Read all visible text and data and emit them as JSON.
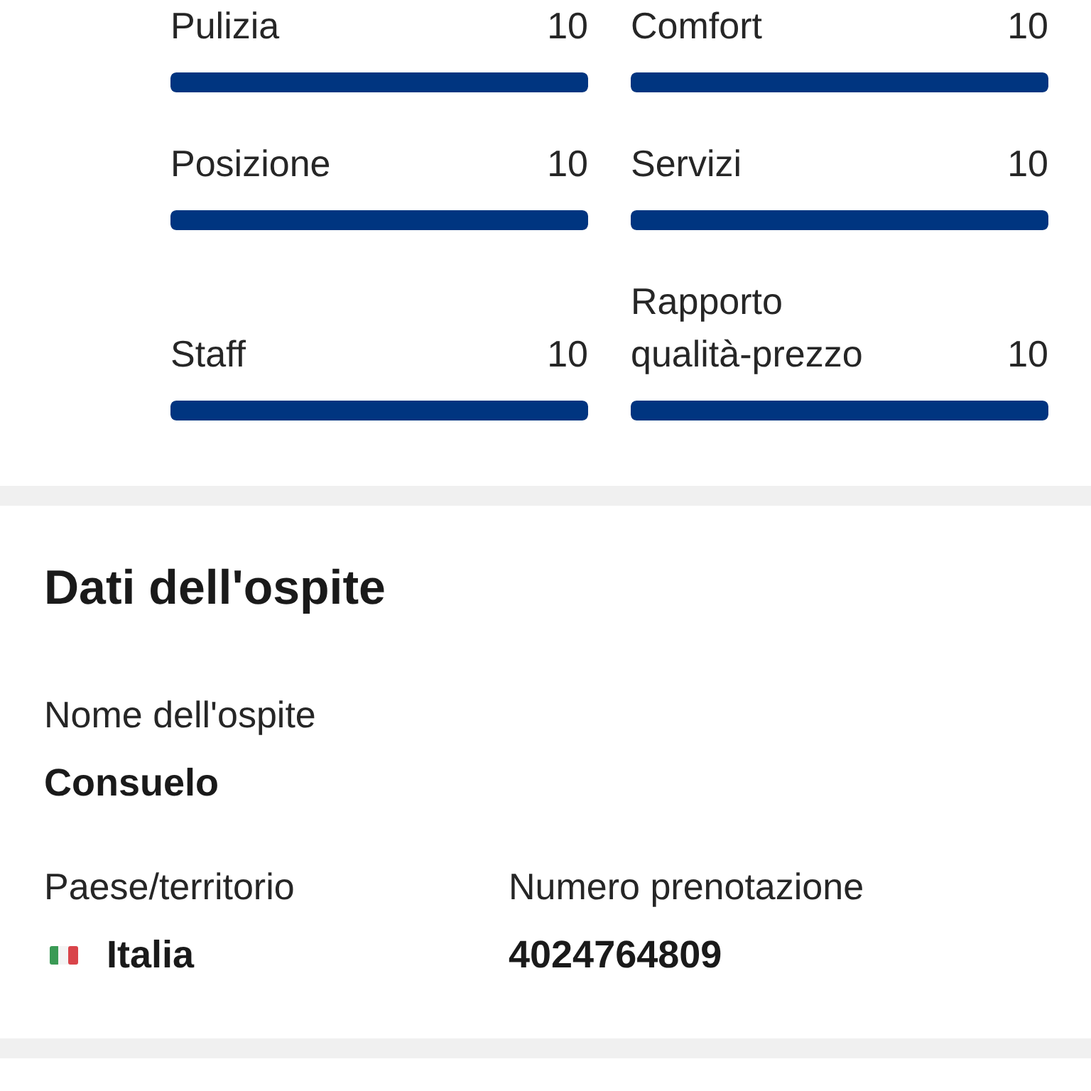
{
  "scores": [
    {
      "label": "Pulizia",
      "value": "10",
      "level": 1
    },
    {
      "label": "Posizione",
      "value": "10",
      "level": 1
    },
    {
      "label": "Staff",
      "value": "10",
      "level": 1
    },
    {
      "label": "Comfort",
      "value": "10",
      "level": 1
    },
    {
      "label": "Servizi",
      "value": "10",
      "level": 1
    },
    {
      "label": "Rapporto qualità-prezzo",
      "value": "10",
      "level": 1
    }
  ],
  "guest_details": {
    "title": "Dati dell'ospite",
    "rows": [
      [
        {
          "kind": "text",
          "label": "Nome dell'ospite",
          "value": "Consuelo"
        }
      ],
      [
        {
          "kind": "country",
          "label": "Paese/territorio",
          "value": "Italia"
        },
        {
          "kind": "text",
          "label": "Numero prenotazione",
          "value": "4024764809"
        }
      ]
    ]
  }
}
